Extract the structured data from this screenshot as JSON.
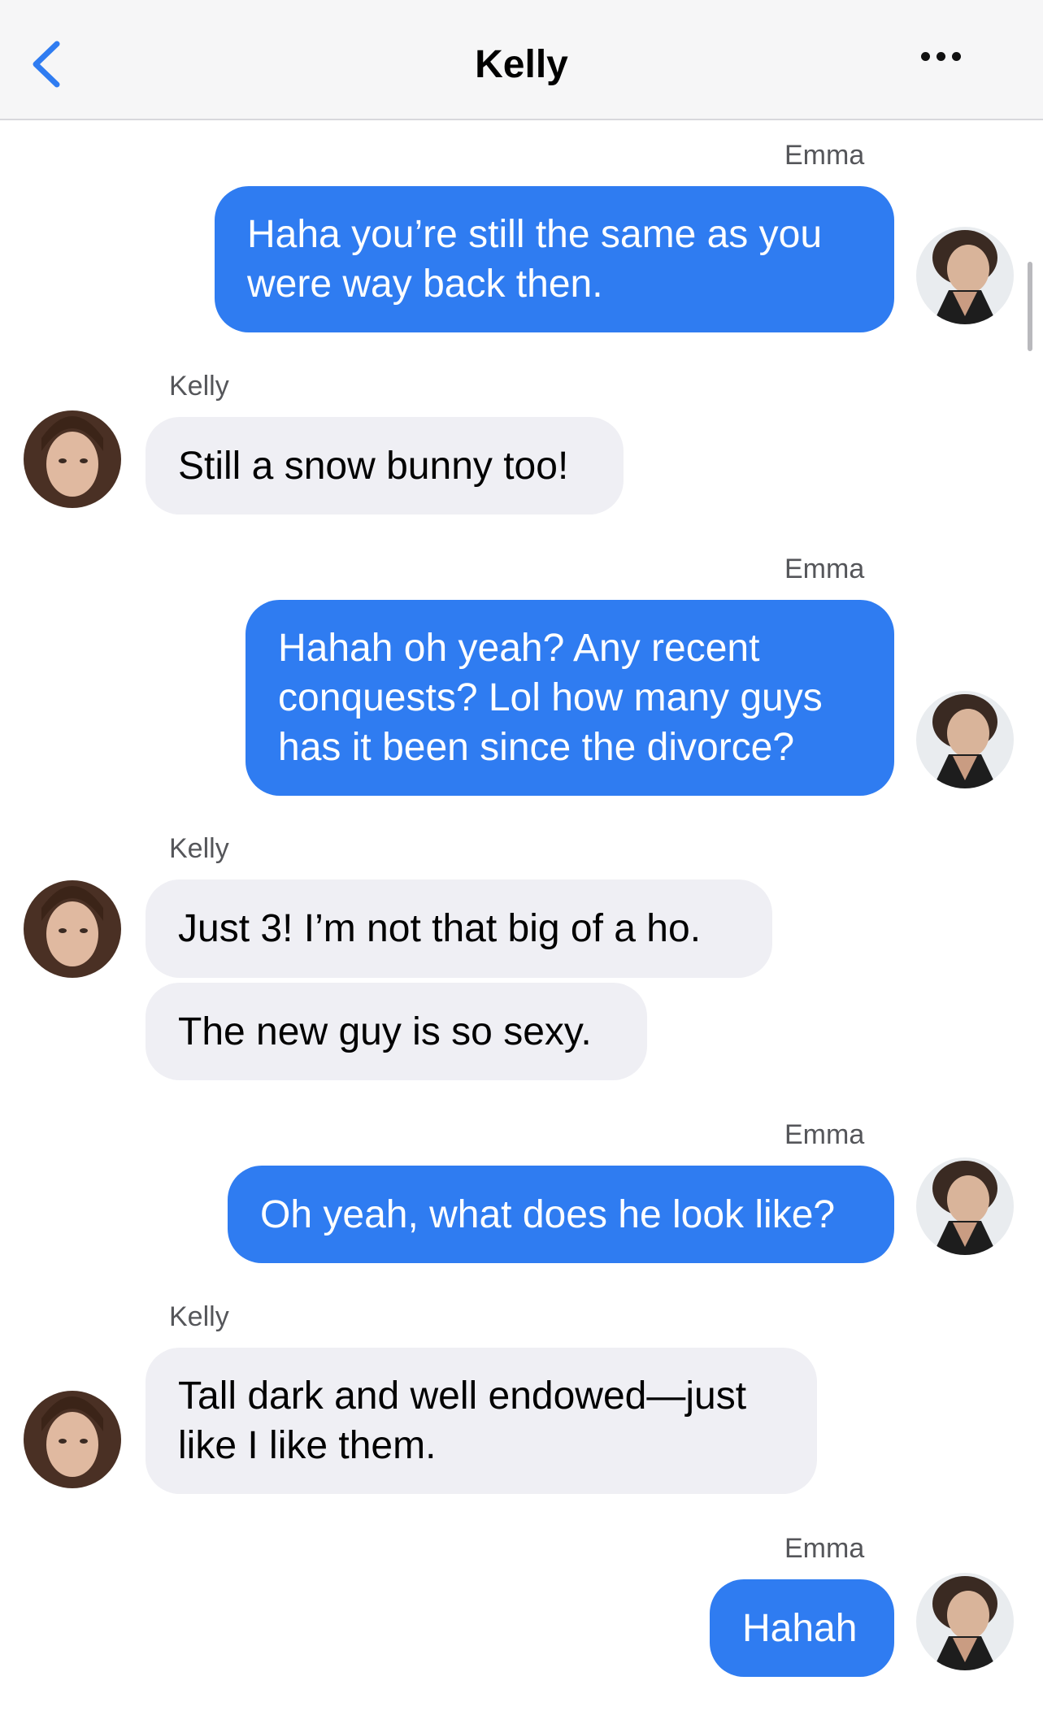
{
  "header": {
    "title": "Kelly",
    "back_icon": "chevron-left-icon",
    "more_icon": "ellipsis-icon",
    "accent": "#2f7cf1"
  },
  "colors": {
    "sent_bubble": "#2f7cf1",
    "received_bubble": "#efeff4"
  },
  "messages": [
    {
      "sender": "Emma",
      "text": "Haha you’re still the same as you were way back then."
    },
    {
      "sender": "Kelly",
      "text": "Still a snow bunny too!"
    },
    {
      "sender": "Emma",
      "text": "Hahah oh yeah? Any recent conquests? Lol how many guys has it been since the divorce?"
    },
    {
      "sender": "Kelly",
      "text": "Just 3! I’m not that big of a ho."
    },
    {
      "sender": "Kelly",
      "text": "The new guy is so sexy."
    },
    {
      "sender": "Emma",
      "text": "Oh yeah, what does he look like?"
    },
    {
      "sender": "Kelly",
      "text": "Tall dark and well endowed—just like I like them."
    },
    {
      "sender": "Emma",
      "text": "Hahah"
    }
  ]
}
